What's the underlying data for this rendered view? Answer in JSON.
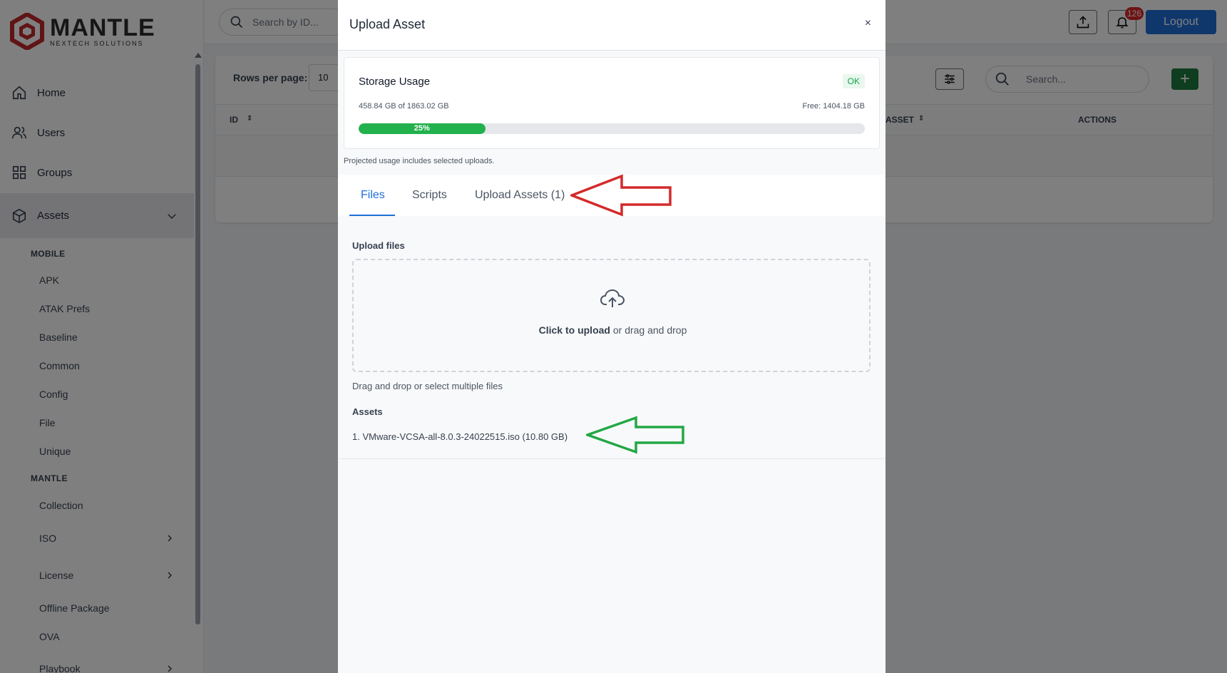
{
  "app": {
    "logo_title": "MANTLE",
    "logo_subtitle": "NEXTECH SOLUTIONS",
    "brand_color": "#c0282d"
  },
  "sidebar": {
    "items": [
      {
        "label": "Home",
        "icon": "home-icon"
      },
      {
        "label": "Users",
        "icon": "users-icon"
      },
      {
        "label": "Groups",
        "icon": "grid-icon"
      },
      {
        "label": "Assets",
        "icon": "cube-icon"
      }
    ],
    "sections": [
      {
        "heading": "MOBILE",
        "items": [
          "APK",
          "ATAK Prefs",
          "Baseline",
          "Common",
          "Config",
          "File",
          "Unique"
        ]
      },
      {
        "heading": "MANTLE",
        "items": [
          "Collection",
          "ISO",
          "License",
          "Offline Package",
          "OVA",
          "Playbook"
        ]
      }
    ]
  },
  "topbar": {
    "search_placeholder": "Search by ID...",
    "notification_count": "126",
    "logout_label": "Logout"
  },
  "content": {
    "rows_per_page_label": "Rows per page:",
    "rows_per_page_value": "10",
    "search_placeholder": "Search...",
    "add_label": "+",
    "columns": [
      "ID",
      "ASSET",
      "ACTIONS"
    ]
  },
  "modal": {
    "title": "Upload Asset",
    "close_label": "×",
    "storage": {
      "title": "Storage Usage",
      "status": "OK",
      "used_text": "458.84 GB of 1863.02 GB",
      "free_text": "Free: 1404.18 GB",
      "percent_label": "25%",
      "percent": 25
    },
    "projected_note": "Projected usage includes selected uploads.",
    "tabs": [
      {
        "label": "Files",
        "active": true
      },
      {
        "label": "Scripts",
        "active": false
      },
      {
        "label": "Upload Assets (1)",
        "active": false
      }
    ],
    "upload_label": "Upload files",
    "dropzone_strong": "Click to upload",
    "dropzone_rest": " or drag and drop",
    "dropzone_help": "Drag and drop or select multiple files",
    "assets_label": "Assets",
    "assets": [
      "1. VMware-VCSA-all-8.0.3-24022515.iso (10.80 GB)"
    ]
  },
  "annotations": {
    "red_arrow_color": "#d42a2a",
    "green_arrow_color": "#22a745"
  }
}
